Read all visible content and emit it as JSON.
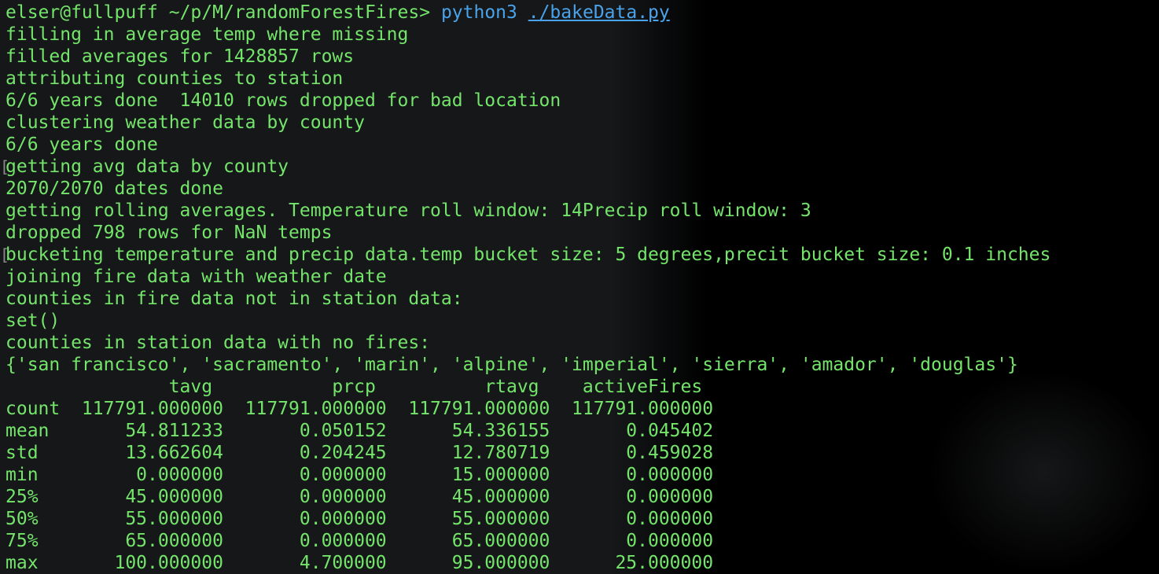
{
  "prompt": {
    "user_host": "elser@fullpuff",
    "path": "~/p/M/randomForestFires>",
    "command": "python3",
    "argument": "./bakeData.py"
  },
  "output_lines": [
    "filling in average temp where missing",
    "filled averages for 1428857 rows",
    "attributing counties to station",
    "6/6 years done  14010 rows dropped for bad location",
    "clustering weather data by county",
    "6/6 years done",
    "getting avg data by county",
    "2070/2070 dates done",
    "getting rolling averages. Temperature roll window: 14Precip roll window: 3",
    "dropped 798 rows for NaN temps",
    "bucketing temperature and precip data.temp bucket size: 5 degrees,precit bucket size: 0.1 inches",
    "joining fire data with weather date",
    "counties in fire data not in station data:",
    "set()",
    "counties in station data with no fires:",
    "{'san francisco', 'sacramento', 'marin', 'alpine', 'imperial', 'sierra', 'amador', 'douglas'}"
  ],
  "table": {
    "header": "               tavg           prcp          rtavg    activeFires",
    "rows": [
      "count  117791.000000  117791.000000  117791.000000  117791.000000",
      "mean       54.811233       0.050152      54.336155       0.045402",
      "std        13.662604       0.204245      12.780719       0.459028",
      "min         0.000000       0.000000      15.000000       0.000000",
      "25%        45.000000       0.000000      45.000000       0.000000",
      "50%        55.000000       0.000000      55.000000       0.000000",
      "75%        65.000000       0.000000      65.000000       0.000000",
      "max       100.000000       4.700000      95.000000      25.000000"
    ]
  },
  "colors": {
    "output_text": "#74e56a",
    "command_text": "#4aa3ea",
    "background": "#151719"
  }
}
